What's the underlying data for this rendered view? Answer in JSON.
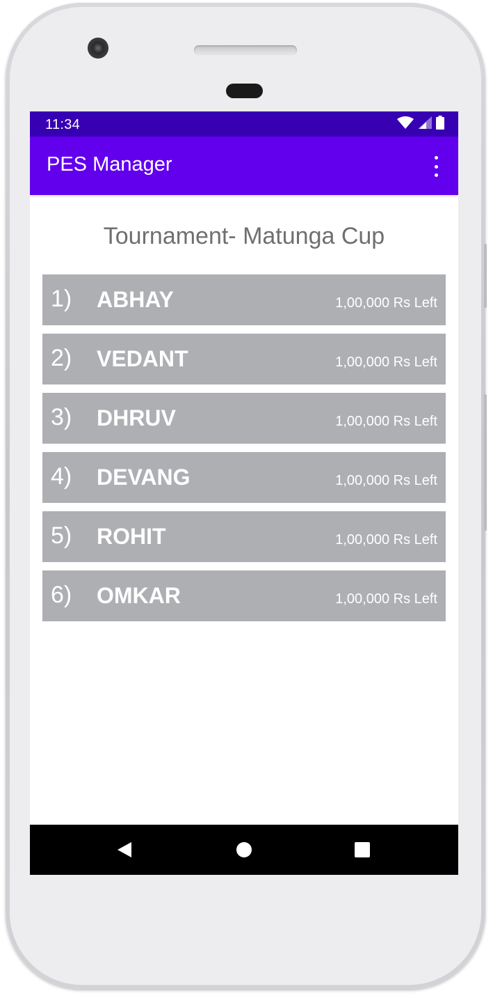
{
  "status_bar": {
    "time": "11:34",
    "icons": [
      "wifi-icon",
      "cell-signal-icon",
      "battery-icon"
    ]
  },
  "app_bar": {
    "title": "PES Manager",
    "menu_icon": "more-vert-icon"
  },
  "tournament": {
    "title": "Tournament-  Matunga Cup"
  },
  "players": [
    {
      "rank": "1)",
      "name": "ABHAY",
      "budget": "1,00,000 Rs Left"
    },
    {
      "rank": "2)",
      "name": "VEDANT",
      "budget": "1,00,000 Rs Left"
    },
    {
      "rank": "3)",
      "name": "DHRUV",
      "budget": "1,00,000 Rs Left"
    },
    {
      "rank": "4)",
      "name": "DEVANG",
      "budget": "1,00,000 Rs Left"
    },
    {
      "rank": "5)",
      "name": "ROHIT",
      "budget": "1,00,000 Rs Left"
    },
    {
      "rank": "6)",
      "name": "OMKAR",
      "budget": "1,00,000 Rs Left"
    }
  ],
  "nav_bar": {
    "buttons": [
      "back-icon",
      "home-icon",
      "recents-icon"
    ]
  },
  "colors": {
    "status_bar": "#3700b3",
    "app_bar": "#6200ee",
    "row_background": "#aeafb3",
    "title_text": "#6f6f6f"
  }
}
